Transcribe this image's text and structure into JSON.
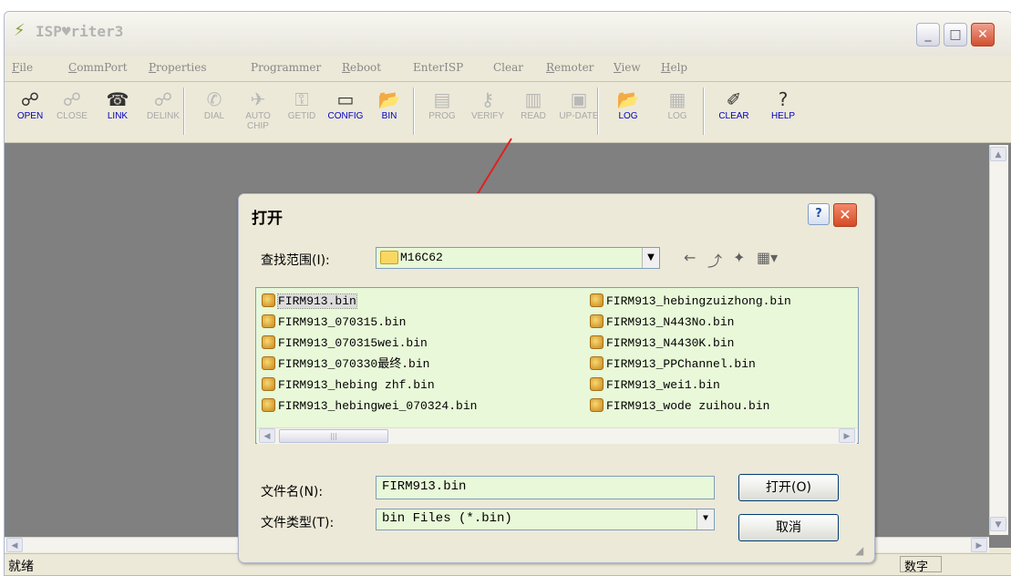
{
  "app": {
    "title": "ISP♥riter3",
    "window_buttons": {
      "minimize": "_",
      "maximize": "□",
      "close": "✕"
    }
  },
  "menu": [
    {
      "label": "File",
      "accel": "F",
      "rest": "ile"
    },
    {
      "label": "CommPort",
      "accel": "C",
      "rest": "ommPort"
    },
    {
      "label": "Properties",
      "accel": "P",
      "rest": "roperties"
    },
    {
      "label": "Programmer",
      "accel": "",
      "rest": "Programmer"
    },
    {
      "label": "Reboot",
      "accel": "R",
      "rest": "eboot"
    },
    {
      "label": "EnterISP",
      "accel": "",
      "rest": "EnterISP"
    },
    {
      "label": "Clear",
      "accel": "",
      "rest": "Clear"
    },
    {
      "label": "Remoter",
      "accel": "R",
      "rest": "emoter"
    },
    {
      "label": "View",
      "accel": "V",
      "rest": "iew"
    },
    {
      "label": "Help",
      "accel": "H",
      "rest": "elp"
    }
  ],
  "toolbar": [
    {
      "label": "OPEN",
      "icon": "open-icon",
      "enabled": true
    },
    {
      "label": "CLOSE",
      "icon": "close-icon",
      "enabled": false
    },
    {
      "label": "LINK",
      "icon": "link-icon",
      "enabled": true
    },
    {
      "label": "DELINK",
      "icon": "delink-icon",
      "enabled": false
    },
    {
      "label": "DIAL",
      "icon": "dial-icon",
      "enabled": false
    },
    {
      "label": "AUTO CHIP",
      "icon": "autochip-icon",
      "enabled": false
    },
    {
      "label": "GETID",
      "icon": "getid-icon",
      "enabled": false
    },
    {
      "label": "CONFIG",
      "icon": "config-icon",
      "enabled": true
    },
    {
      "label": "BIN",
      "icon": "bin-icon",
      "enabled": true
    },
    {
      "label": "PROG",
      "icon": "prog-icon",
      "enabled": false
    },
    {
      "label": "VERIFY",
      "icon": "verify-icon",
      "enabled": false
    },
    {
      "label": "READ",
      "icon": "read-icon",
      "enabled": false
    },
    {
      "label": "UP-DATE",
      "icon": "update-icon",
      "enabled": false
    },
    {
      "label": "LOG",
      "icon": "log-icon",
      "enabled": true
    },
    {
      "label": "LOG",
      "icon": "log2-icon",
      "enabled": false
    },
    {
      "label": "CLEAR",
      "icon": "clear-icon",
      "enabled": true
    },
    {
      "label": "HELP",
      "icon": "help-icon",
      "enabled": true
    }
  ],
  "status": {
    "text": "就绪",
    "num": "数字"
  },
  "dialog": {
    "title": "打开",
    "help_glyph": "?",
    "close_glyph": "✕",
    "lookin_label": "查找范围(I):",
    "lookin_value": "M16C62",
    "files_left": [
      "FIRM913.bin",
      "FIRM913_070315.bin",
      "FIRM913_070315wei.bin",
      "FIRM913_070330最终.bin",
      "FIRM913_hebing zhf.bin",
      "FIRM913_hebingwei_070324.bin"
    ],
    "files_right": [
      "FIRM913_hebingzuizhong.bin",
      "FIRM913_N443No.bin",
      "FIRM913_N4430K.bin",
      "FIRM913_PPChannel.bin",
      "FIRM913_wei1.bin",
      "FIRM913_wode zuihou.bin"
    ],
    "selected_file": "FIRM913.bin",
    "filename_label": "文件名(N):",
    "filename_value": "FIRM913.bin",
    "filetype_label": "文件类型(T):",
    "filetype_value": "bin Files (*.bin)",
    "open_button": "打开(O)",
    "cancel_button": "取消"
  },
  "colors": {
    "annotation": "#e02020",
    "field_bg": "#e8f8d8",
    "enabled_label": "#0000c0"
  }
}
